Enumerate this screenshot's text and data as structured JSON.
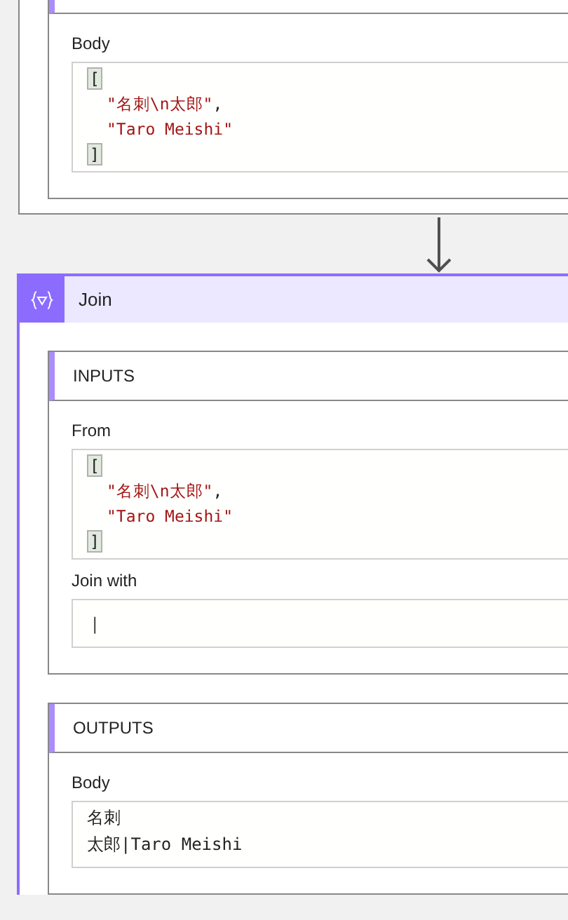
{
  "previous_card": {
    "sections": [
      {
        "fields": [
          {
            "label": "Body",
            "kind": "code",
            "lines": [
              {
                "kind": "bracket",
                "text": "["
              },
              {
                "kind": "string",
                "text": "\"名刺\\n太郎\"",
                "trail": ","
              },
              {
                "kind": "string",
                "text": "\"Taro Meishi\""
              },
              {
                "kind": "bracket",
                "text": "]"
              }
            ]
          }
        ]
      }
    ]
  },
  "action": {
    "title": "Join",
    "sections": [
      {
        "title": "INPUTS",
        "fields": [
          {
            "label": "From",
            "kind": "code",
            "lines": [
              {
                "kind": "bracket",
                "text": "["
              },
              {
                "kind": "string",
                "text": "\"名刺\\n太郎\"",
                "trail": ","
              },
              {
                "kind": "string",
                "text": "\"Taro Meishi\""
              },
              {
                "kind": "bracket",
                "text": "]"
              }
            ]
          },
          {
            "label": "Join with",
            "kind": "input",
            "value": "|"
          }
        ]
      },
      {
        "title": "OUTPUTS",
        "fields": [
          {
            "label": "Body",
            "kind": "plain",
            "lines": [
              {
                "kind": "plain",
                "text": "名刺"
              },
              {
                "kind": "plain",
                "text": "太郎|Taro Meishi"
              }
            ]
          }
        ]
      }
    ]
  }
}
